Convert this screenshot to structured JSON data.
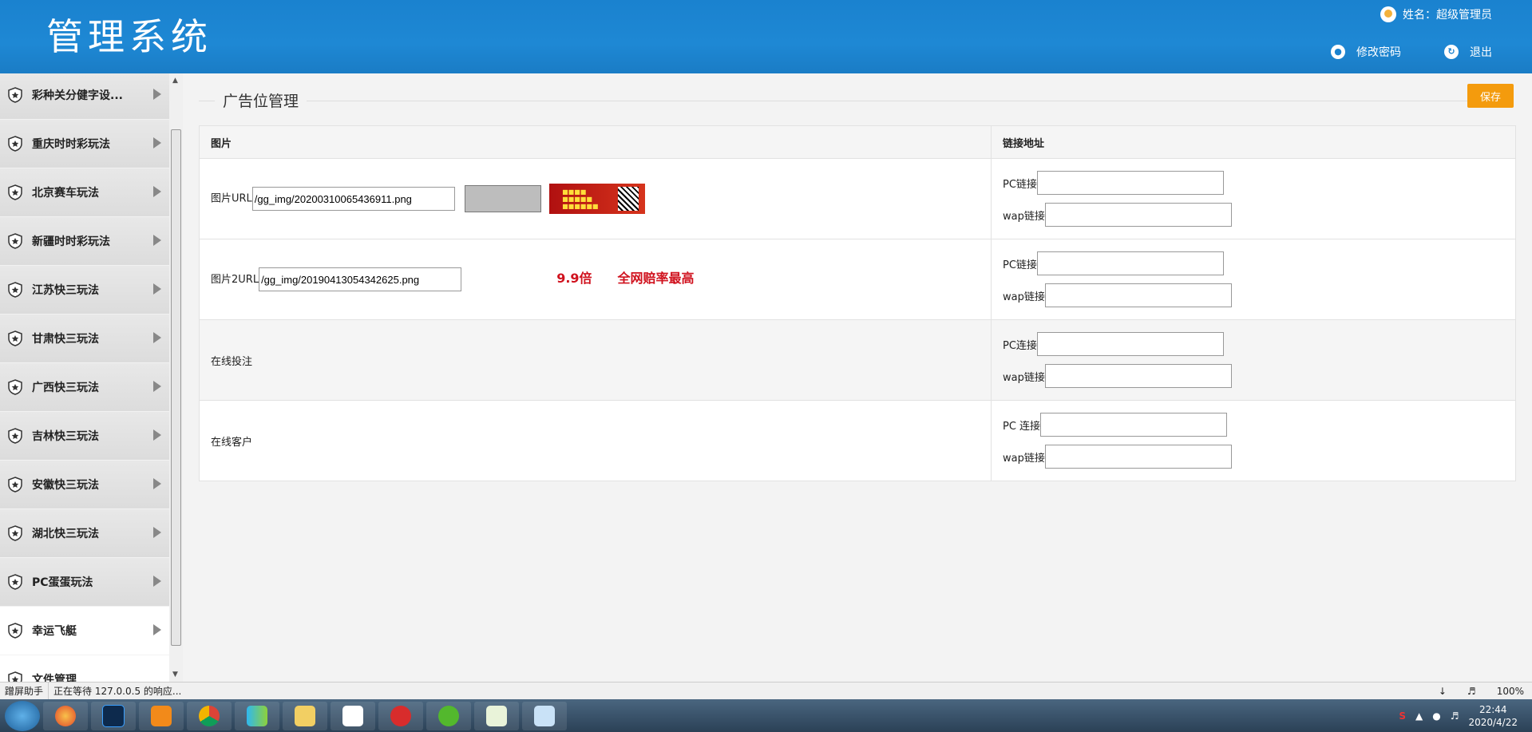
{
  "header": {
    "logo": "管理系统",
    "user_label": "姓名：超级管理员",
    "change_password": "修改密码",
    "logout": "退出"
  },
  "sidebar": {
    "items": [
      {
        "label": "彩种关分健字设..."
      },
      {
        "label": "重庆时时彩玩法"
      },
      {
        "label": "北京赛车玩法"
      },
      {
        "label": "新疆时时彩玩法"
      },
      {
        "label": "江苏快三玩法"
      },
      {
        "label": "甘肃快三玩法"
      },
      {
        "label": "广西快三玩法"
      },
      {
        "label": "吉林快三玩法"
      },
      {
        "label": "安徽快三玩法"
      },
      {
        "label": "湖北快三玩法"
      },
      {
        "label": "PC蛋蛋玩法"
      },
      {
        "label": "幸运飞艇"
      },
      {
        "label": "文件管理"
      }
    ]
  },
  "main": {
    "title": "广告位管理",
    "save": "保存",
    "col_image": "图片",
    "col_link": "链接地址",
    "rows": [
      {
        "label": "图片URL",
        "url": "/gg_img/20200310065436911.png",
        "pc_label": "PC链接",
        "wap_label": "wap链接"
      },
      {
        "label": "图片2URL",
        "url": "/gg_img/20190413054342625.png",
        "image_text": "9.9倍　　全网赔率最高",
        "pc_label": "PC链接",
        "wap_label": "wap链接"
      },
      {
        "label": "在线投注",
        "pc_label": "PC连接",
        "wap_label": "wap链接"
      },
      {
        "label": "在线客户",
        "pc_label": "PC 连接",
        "wap_label": "wap链接"
      }
    ]
  },
  "statusbar": {
    "assistant": "蹭屏助手",
    "status": "正在等待 127.0.0.5 的响应...",
    "zoom": "100%"
  },
  "taskbar": {
    "time": "22:44",
    "date": "2020/4/22"
  }
}
